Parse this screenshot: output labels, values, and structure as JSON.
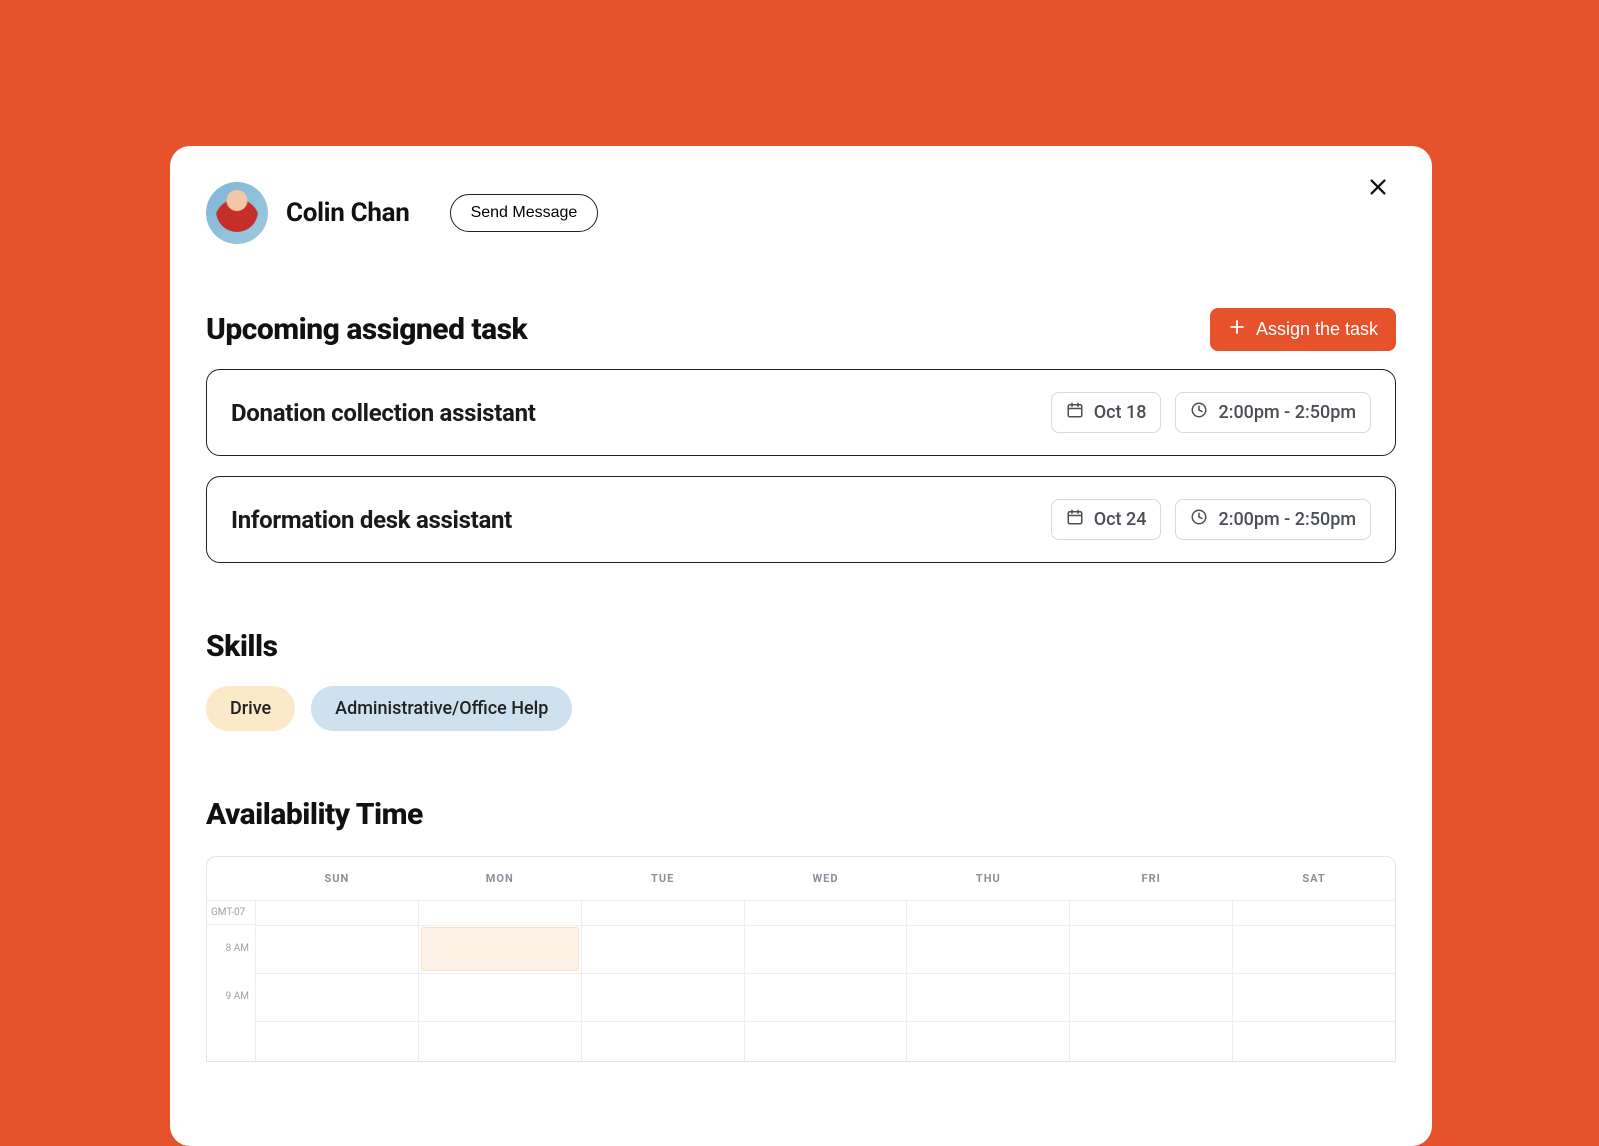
{
  "colors": {
    "accent": "#E6522C",
    "skill_drive_bg": "#FCE9C8",
    "skill_admin_bg": "#CDE2EE"
  },
  "user": {
    "name": "Colin Chan"
  },
  "buttons": {
    "send_message": "Send Message",
    "assign_task": "Assign the task"
  },
  "sections": {
    "upcoming": "Upcoming assigned task",
    "skills": "Skills",
    "availability": "Availability Time"
  },
  "tasks": [
    {
      "title": "Donation collection assistant",
      "date": "Oct 18",
      "time": "2:00pm - 2:50pm"
    },
    {
      "title": "Information desk assistant",
      "date": "Oct 24",
      "time": "2:00pm - 2:50pm"
    }
  ],
  "skills": {
    "drive": "Drive",
    "admin": "Administrative/Office Help"
  },
  "calendar": {
    "timezone": "GMT-07",
    "days": [
      "SUN",
      "MON",
      "TUE",
      "WED",
      "THU",
      "FRI",
      "SAT"
    ],
    "hours": [
      "8 AM",
      "9 AM"
    ],
    "events": [
      {
        "day": 1,
        "hour_index": 0,
        "label": ""
      }
    ]
  }
}
